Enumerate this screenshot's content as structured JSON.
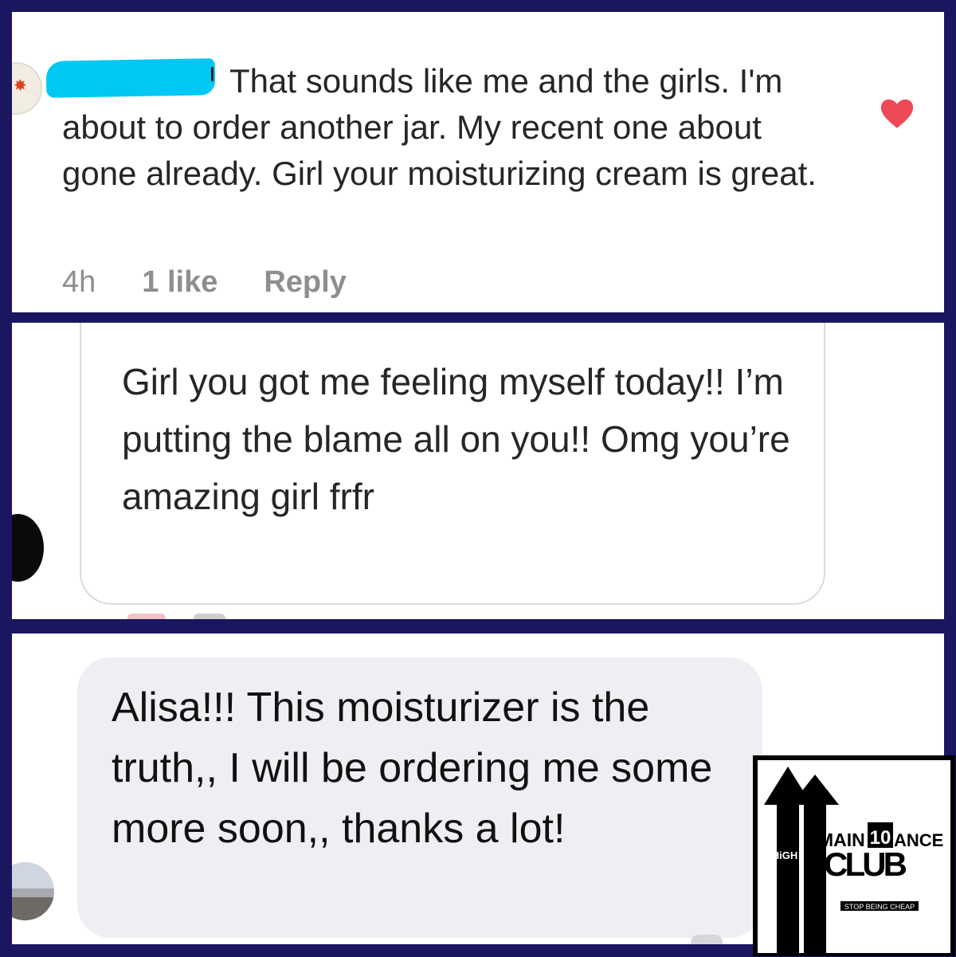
{
  "panel1": {
    "comment_text": "That sounds like me and the girls. I'm about to order another jar. My recent one about gone already. Girl your moisturizing cream is great.",
    "time": "4h",
    "likes": "1 like",
    "reply": "Reply",
    "liked": true
  },
  "panel2": {
    "message": "Girl you got me feeling myself today!! I’m putting the blame all on you!! Omg you’re amazing girl frfr"
  },
  "panel3": {
    "message": "Alisa!!! This moisturizer is the truth,, I will be ordering me some more soon,, thanks a lot!"
  },
  "logo": {
    "high": "HiGH",
    "main": "MAIN",
    "ten": "10",
    "ance": "ANCE",
    "club": "CLUB",
    "tagline": "STOP BEING CHEAP"
  },
  "colors": {
    "frame": "#1a1660",
    "redaction": "#00c8f5",
    "heart": "#ed4956",
    "meta_text": "#8e8e8e",
    "bubble_gray": "#efeef2"
  },
  "icons": {
    "like": "heart-icon",
    "badge": "star-icon"
  }
}
